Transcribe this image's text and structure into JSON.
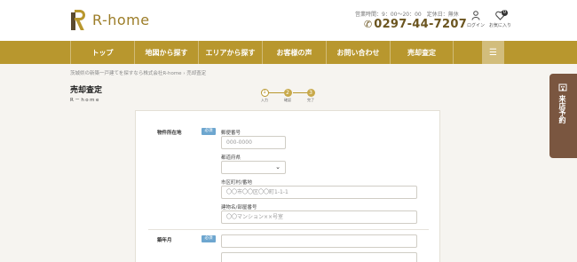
{
  "header": {
    "logo_text": "R-home",
    "hours": "営業時間：9：00～20：00　定休日：無休",
    "phone": "0297-44-7207",
    "login_label": "ログイン",
    "favorites_label": "お気に入り",
    "favorites_count": "0"
  },
  "nav": {
    "items": [
      {
        "label": "トップ"
      },
      {
        "label": "地図から探す"
      },
      {
        "label": "エリアから探す"
      },
      {
        "label": "お客様の声"
      },
      {
        "label": "お問い合わせ"
      },
      {
        "label": "売却査定"
      }
    ],
    "menu_icon": "hamburger-icon"
  },
  "breadcrumb": {
    "home": "茨城県の新築一戸建てを探すなら株式会社R-home",
    "separator": "›",
    "current": "売却査定"
  },
  "page": {
    "title": "売却査定",
    "subtitle": "R－home"
  },
  "steps": [
    {
      "num": "1",
      "label": "入力",
      "active": true
    },
    {
      "num": "2",
      "label": "確認",
      "active": false
    },
    {
      "num": "3",
      "label": "完了",
      "active": false
    }
  ],
  "form": {
    "property_location": {
      "label": "物件所在地",
      "required_badge": "必須",
      "postal_label": "郵便番号",
      "postal_placeholder": "000-0000",
      "prefecture_label": "都道府県",
      "prefecture_value": "",
      "city_label": "市区町村/番地",
      "city_placeholder": "〇〇市〇〇区〇〇町1-1-1",
      "building_label": "建物名/部屋番号",
      "building_placeholder": "〇〇マンション××号室"
    },
    "year_built": {
      "label": "築年月",
      "required_badge": "必須"
    }
  },
  "sidetab": {
    "icon": "building-icon",
    "text": "来店予約"
  },
  "colors": {
    "gold": "#b8972e",
    "brown": "#7a5640",
    "required_blue": "#6da6cf"
  }
}
